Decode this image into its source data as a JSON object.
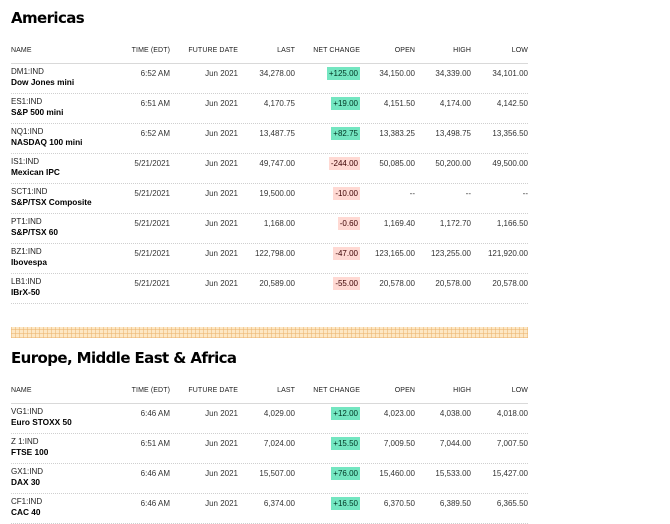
{
  "americas": {
    "title": "Americas",
    "headers": [
      "NAME",
      "TIME (EDT)",
      "FUTURE DATE",
      "LAST",
      "NET CHANGE",
      "OPEN",
      "HIGH",
      "LOW"
    ],
    "rows": [
      {
        "symbol": "DM1:IND",
        "name": "Dow Jones mini",
        "time": "6:52 AM",
        "future": "Jun 2021",
        "last": "34,278.00",
        "change": "+125.00",
        "dir": "pos",
        "open": "34,150.00",
        "high": "34,339.00",
        "low": "34,101.00"
      },
      {
        "symbol": "ES1:IND",
        "name": "S&P 500 mini",
        "time": "6:51 AM",
        "future": "Jun 2021",
        "last": "4,170.75",
        "change": "+19.00",
        "dir": "pos",
        "open": "4,151.50",
        "high": "4,174.00",
        "low": "4,142.50"
      },
      {
        "symbol": "NQ1:IND",
        "name": "NASDAQ 100 mini",
        "time": "6:52 AM",
        "future": "Jun 2021",
        "last": "13,487.75",
        "change": "+82.75",
        "dir": "pos",
        "open": "13,383.25",
        "high": "13,498.75",
        "low": "13,356.50"
      },
      {
        "symbol": "IS1:IND",
        "name": "Mexican IPC",
        "time": "5/21/2021",
        "future": "Jun 2021",
        "last": "49,747.00",
        "change": "-244.00",
        "dir": "neg",
        "open": "50,085.00",
        "high": "50,200.00",
        "low": "49,500.00"
      },
      {
        "symbol": "SCT1:IND",
        "name": "S&P/TSX Composite",
        "time": "5/21/2021",
        "future": "Jun 2021",
        "last": "19,500.00",
        "change": "-10.00",
        "dir": "neg",
        "open": "--",
        "high": "--",
        "low": "--"
      },
      {
        "symbol": "PT1:IND",
        "name": "S&P/TSX 60",
        "time": "5/21/2021",
        "future": "Jun 2021",
        "last": "1,168.00",
        "change": "-0.60",
        "dir": "neg",
        "open": "1,169.40",
        "high": "1,172.70",
        "low": "1,166.50"
      },
      {
        "symbol": "BZ1:IND",
        "name": "Ibovespa",
        "time": "5/21/2021",
        "future": "Jun 2021",
        "last": "122,798.00",
        "change": "-47.00",
        "dir": "neg",
        "open": "123,165.00",
        "high": "123,255.00",
        "low": "121,920.00"
      },
      {
        "symbol": "LB1:IND",
        "name": "IBrX-50",
        "time": "5/21/2021",
        "future": "Jun 2021",
        "last": "20,589.00",
        "change": "-55.00",
        "dir": "neg",
        "open": "20,578.00",
        "high": "20,578.00",
        "low": "20,578.00"
      }
    ]
  },
  "emea": {
    "title": "Europe, Middle East & Africa",
    "headers": [
      "NAME",
      "TIME (EDT)",
      "FUTURE DATE",
      "LAST",
      "NET CHANGE",
      "OPEN",
      "HIGH",
      "LOW"
    ],
    "rows": [
      {
        "symbol": "VG1:IND",
        "name": "Euro STOXX 50",
        "time": "6:46 AM",
        "future": "Jun 2021",
        "last": "4,029.00",
        "change": "+12.00",
        "dir": "pos",
        "open": "4,023.00",
        "high": "4,038.00",
        "low": "4,018.00"
      },
      {
        "symbol": "Z 1:IND",
        "name": "FTSE 100",
        "time": "6:51 AM",
        "future": "Jun 2021",
        "last": "7,024.00",
        "change": "+15.50",
        "dir": "pos",
        "open": "7,009.50",
        "high": "7,044.00",
        "low": "7,007.50"
      },
      {
        "symbol": "GX1:IND",
        "name": "DAX 30",
        "time": "6:46 AM",
        "future": "Jun 2021",
        "last": "15,507.00",
        "change": "+76.00",
        "dir": "pos",
        "open": "15,460.00",
        "high": "15,533.00",
        "low": "15,427.00"
      },
      {
        "symbol": "CF1:IND",
        "name": "CAC 40",
        "time": "6:46 AM",
        "future": "Jun 2021",
        "last": "6,374.00",
        "change": "+16.50",
        "dir": "pos",
        "open": "6,370.50",
        "high": "6,389.50",
        "low": "6,365.50"
      }
    ]
  },
  "colors": {
    "positive_bg": "#74e6c1",
    "negative_bg": "#ffd9d3",
    "divider": "#fde7c4"
  }
}
